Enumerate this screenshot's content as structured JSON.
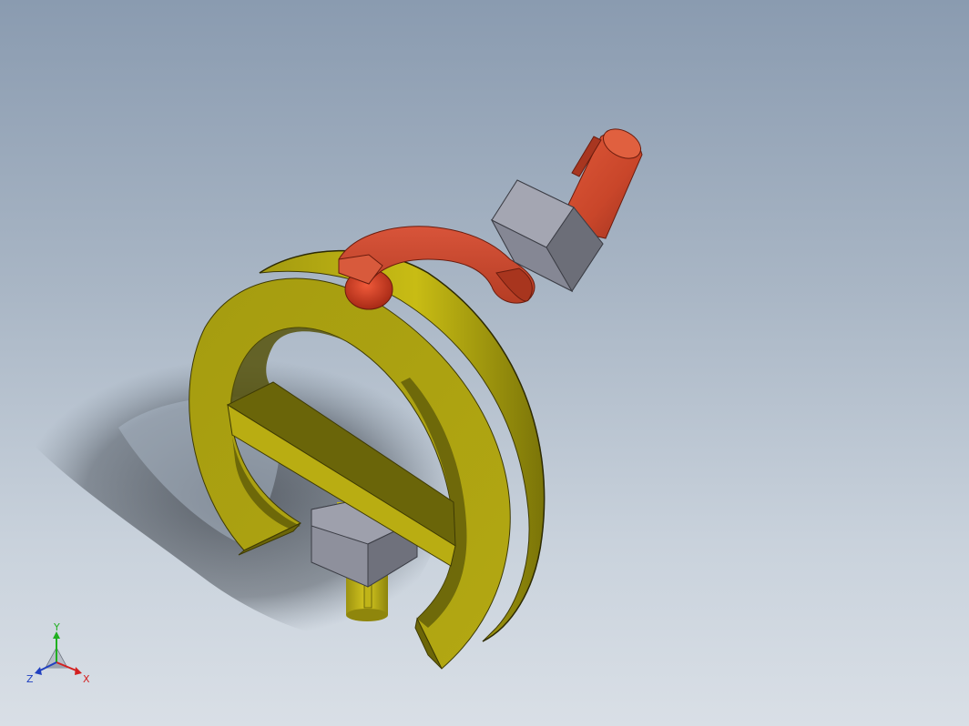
{
  "viewport": {
    "background_top": "#8a9bb0",
    "background_bottom": "#d9dfe6"
  },
  "model": {
    "parts": [
      {
        "name": "yellow-ring-frame",
        "color": "#b9ae12"
      },
      {
        "name": "red-bent-arm",
        "color": "#cc4a2c"
      },
      {
        "name": "gray-hex-nut-upper",
        "color": "#8a8c98"
      },
      {
        "name": "gray-hex-nut-lower",
        "color": "#8a8c98"
      },
      {
        "name": "yellow-pin",
        "color": "#c8b81a"
      }
    ]
  },
  "triad": {
    "x_label": "X",
    "y_label": "Y",
    "z_label": "Z",
    "x_color": "#d32020",
    "y_color": "#20b020",
    "z_color": "#2040c0"
  }
}
